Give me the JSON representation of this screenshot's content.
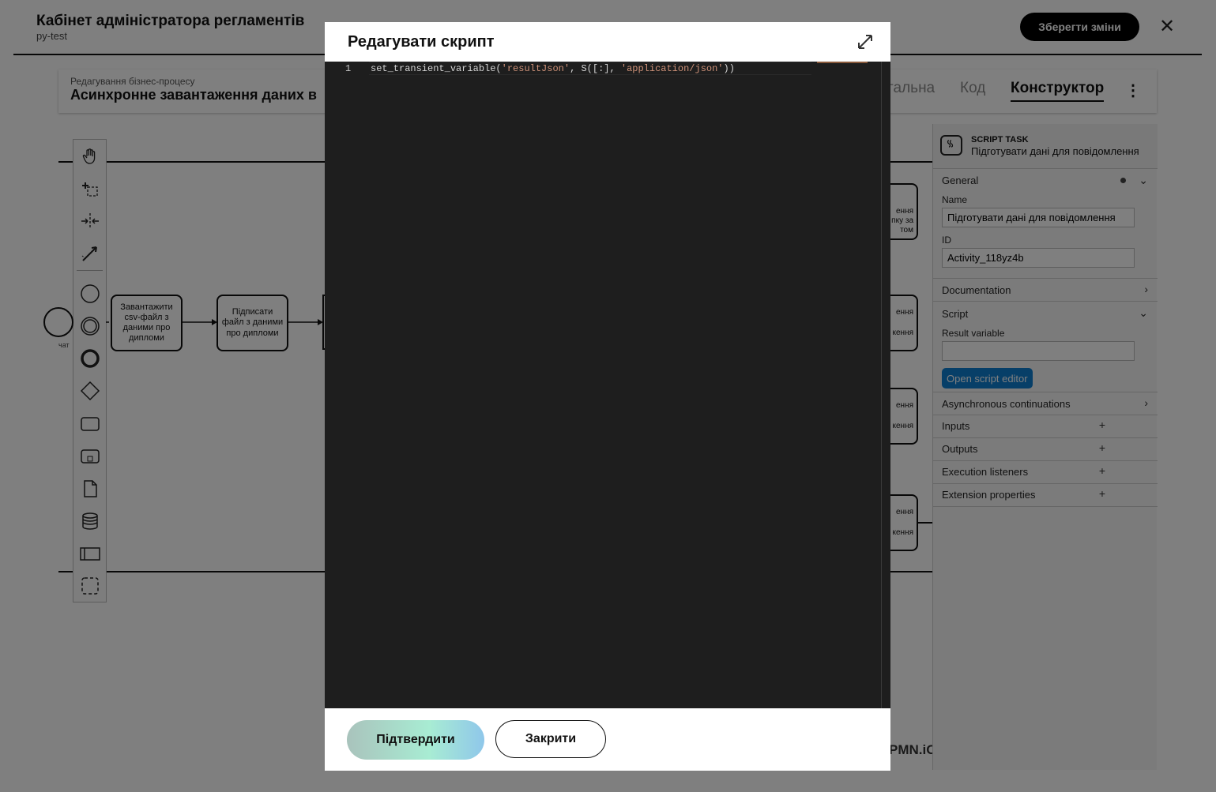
{
  "header": {
    "title": "Кабінет адміністратора регламентів",
    "subtitle": "py-test",
    "save_label": "Зберегти зміни"
  },
  "process": {
    "caption": "Редагування бізнес-процесу",
    "name": "Асинхронне завантаження даних в",
    "tabs": [
      {
        "label": "гальна"
      },
      {
        "label": "Код"
      },
      {
        "label": "Конструктор"
      }
    ]
  },
  "diagram": {
    "start_label": "чат",
    "tasks": [
      {
        "label": "Завантажити csv-файл з даними про дипломи"
      },
      {
        "label": "Підписати файл з даними про дипломи"
      }
    ],
    "right_fragments": [
      "ення",
      "пку за",
      "том",
      "ення",
      "кення",
      "ення",
      "кення",
      "ення",
      "кення"
    ],
    "logo": "PMN.iO"
  },
  "properties": {
    "type": "SCRIPT TASK",
    "element_name": "Підготувати дані для повідомлення",
    "general": "General",
    "name_label": "Name",
    "name_value": "Підготувати дані для повідомлення",
    "id_label": "ID",
    "id_value": "Activity_118yz4b",
    "documentation": "Documentation",
    "script": "Script",
    "result_variable_label": "Result variable",
    "result_variable_value": "",
    "open_script_editor": "Open script editor",
    "async": "Asynchronous continuations",
    "inputs": "Inputs",
    "outputs": "Outputs",
    "execution_listeners": "Execution listeners",
    "extension_properties": "Extension properties"
  },
  "modal": {
    "title": "Редагувати скрипт",
    "code": {
      "line_number": "1",
      "prefix": "set_transient_variable(",
      "str1": "'resultJson'",
      "mid": ", S([:], ",
      "str2": "'application/json'",
      "suffix": "))"
    },
    "confirm_label": "Підтвердити",
    "close_label": "Закрити"
  }
}
